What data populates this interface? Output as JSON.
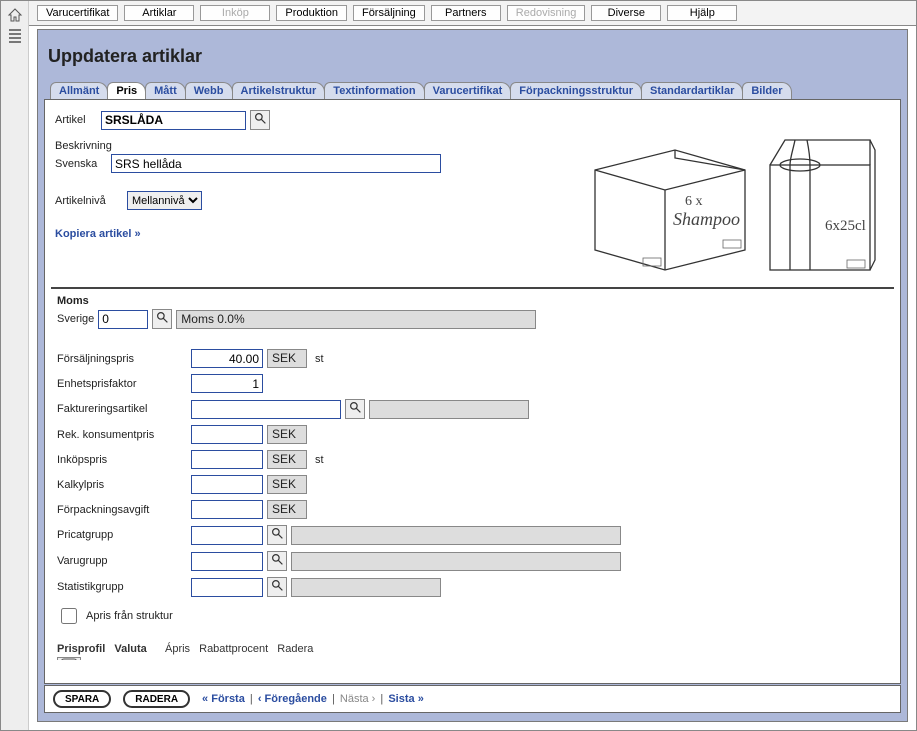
{
  "topmenu": {
    "varucertifikat": "Varucertifikat",
    "artiklar": "Artiklar",
    "inkop": "Inköp",
    "produktion": "Produktion",
    "forsaljning": "Försäljning",
    "partners": "Partners",
    "redovisning": "Redovisning",
    "diverse": "Diverse",
    "hjalp": "Hjälp"
  },
  "page_title": "Uppdatera artiklar",
  "tabs": {
    "allmant": "Allmänt",
    "pris": "Pris",
    "matt": "Mått",
    "webb": "Webb",
    "artikelstruktur": "Artikelstruktur",
    "textinformation": "Textinformation",
    "varucertifikat": "Varucertifikat",
    "forpackningsstruktur": "Förpackningsstruktur",
    "standardartiklar": "Standardartiklar",
    "bilder": "Bilder"
  },
  "fields": {
    "artikel_label": "Artikel",
    "artikel_value": "SRSLÅDA",
    "beskrivning_label": "Beskrivning",
    "svenska_label": "Svenska",
    "svenska_value": "SRS hellåda",
    "artikelniva_label": "Artikelnivå",
    "artikelniva_value": "Mellannivå",
    "kopiera": "Kopiera artikel »"
  },
  "moms": {
    "title": "Moms",
    "sverige_label": "Sverige",
    "sverige_value": "0",
    "moms_text": "Moms 0.0%"
  },
  "pricing": {
    "forsaljningspris_label": "Försäljningspris",
    "forsaljningspris_value": "40.00",
    "sek": "SEK",
    "st": "st",
    "enhetsprisfaktor_label": "Enhetsprisfaktor",
    "enhetsprisfaktor_value": "1",
    "faktureringsartikel_label": "Faktureringsartikel",
    "faktureringsartikel_value": "",
    "rek_konsumentpris_label": "Rek. konsumentpris",
    "rek_konsumentpris_value": "",
    "inkopspris_label": "Inköpspris",
    "inkopspris_value": "",
    "kalkylpris_label": "Kalkylpris",
    "kalkylpris_value": "",
    "forpackningsavgift_label": "Förpackningsavgift",
    "forpackningsavgift_value": "",
    "pricatgrupp_label": "Pricatgrupp",
    "pricatgrupp_value": "",
    "varugrupp_label": "Varugrupp",
    "varugrupp_value": "",
    "statistikgrupp_label": "Statistikgrupp",
    "statistikgrupp_value": "",
    "apris_fr_struktur_label": "Apris från struktur"
  },
  "tablecols": {
    "prisprofil": "Prisprofil",
    "valuta": "Valuta",
    "apris": "Ápris",
    "rabattprocent": "Rabattprocent",
    "radera": "Radera"
  },
  "footer": {
    "spara": "SPARA",
    "radera": "RADERA",
    "forsta": "« Första",
    "foregaende": "‹ Föregående",
    "nasta": "Nästa ›",
    "sista": "Sista »"
  },
  "box_art": {
    "box_line1": "6 x",
    "box_line2": "Shampoo",
    "pack_label": "6x25cl"
  }
}
